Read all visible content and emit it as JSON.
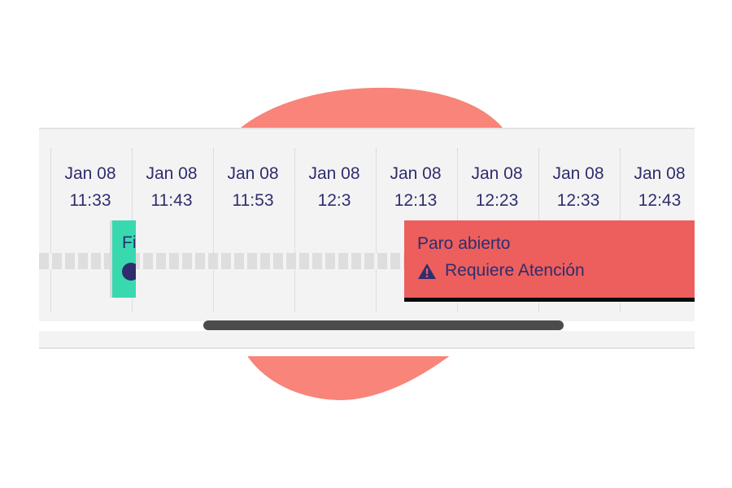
{
  "timeline": {
    "time_labels": [
      {
        "date": "Jan 08",
        "time": "11:33"
      },
      {
        "date": "Jan 08",
        "time": "11:43"
      },
      {
        "date": "Jan 08",
        "time": "11:53"
      },
      {
        "date": "Jan 08",
        "time": "12:3"
      },
      {
        "date": "Jan 08",
        "time": "12:13"
      },
      {
        "date": "Jan 08",
        "time": "12:23"
      },
      {
        "date": "Jan 08",
        "time": "12:33"
      },
      {
        "date": "Jan 08",
        "time": "12:43"
      }
    ],
    "events": [
      {
        "label": "Fi",
        "color": "#39d9b0",
        "icon": "clock-icon"
      },
      {
        "label": "Paro abierto",
        "status": "Requiere Atención",
        "color": "#ec5f5c",
        "icon": "warning-icon"
      }
    ]
  },
  "colors": {
    "accent_blob": "#f8847a",
    "text": "#2f2d6e",
    "track_bg": "#f3f3f3"
  }
}
